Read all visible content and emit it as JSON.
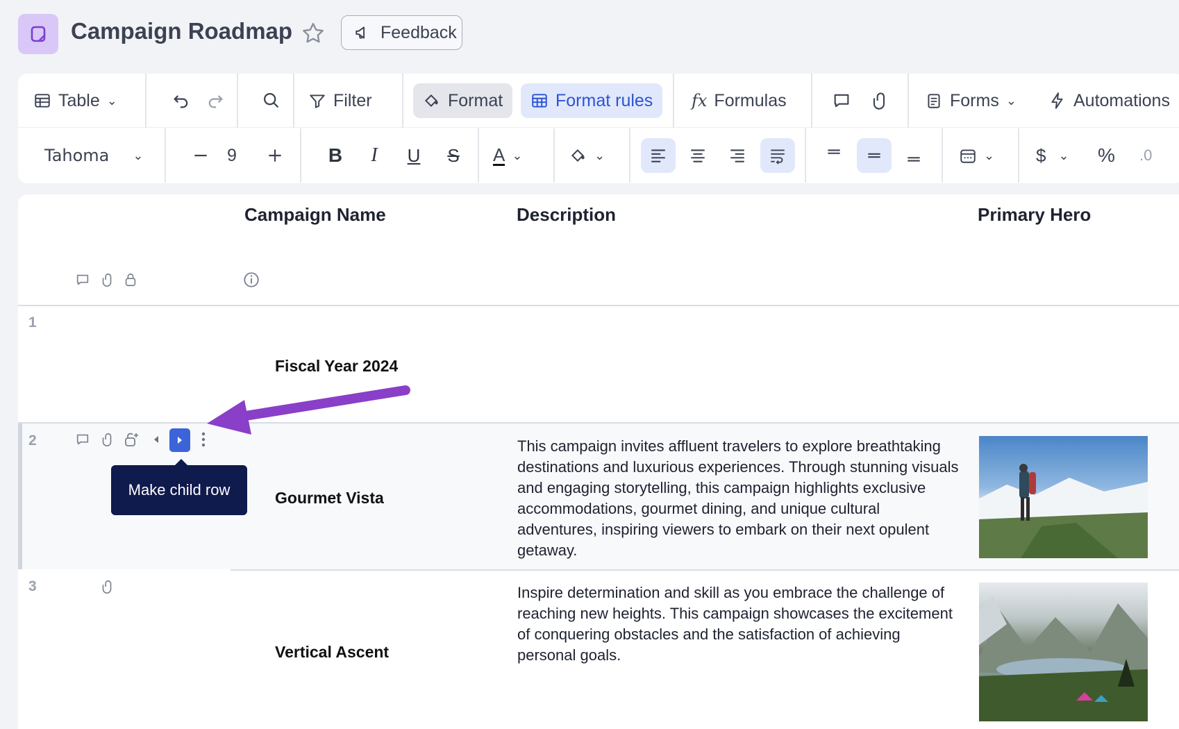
{
  "header": {
    "title": "Campaign Roadmap",
    "feedback_label": "Feedback"
  },
  "toolbar": {
    "view_label": "Table",
    "filter_label": "Filter",
    "format_label": "Format",
    "format_rules_label": "Format rules",
    "formulas_label": "Formulas",
    "forms_label": "Forms",
    "automations_label": "Automations",
    "font_family": "Tahoma",
    "font_size": "9",
    "currency_symbol": "$",
    "percent_symbol": "%"
  },
  "columns": {
    "name": "Campaign Name",
    "description": "Description",
    "hero": "Primary Hero"
  },
  "rows": [
    {
      "num": "1",
      "name": "Fiscal Year 2024",
      "description": ""
    },
    {
      "num": "2",
      "name": "Gourmet Vista",
      "description": "This campaign invites affluent travelers to explore breathtaking destinations and luxurious experiences. Through stunning visuals and engaging storytelling, this campaign highlights exclusive accommodations, gourmet dining, and unique cultural adventures, inspiring viewers to embark on their next opulent getaway."
    },
    {
      "num": "3",
      "name": "Vertical Ascent",
      "description": "Inspire determination and skill as you embrace the challenge of reaching new heights. This campaign showcases the excitement of conquering obstacles and the satisfaction of achieving personal goals."
    }
  ],
  "tooltip": "Make child row",
  "colors": {
    "accent": "#2a55d3",
    "annotation_arrow": "#8a3fc8",
    "tooltip_bg": "#0f1a4d"
  }
}
